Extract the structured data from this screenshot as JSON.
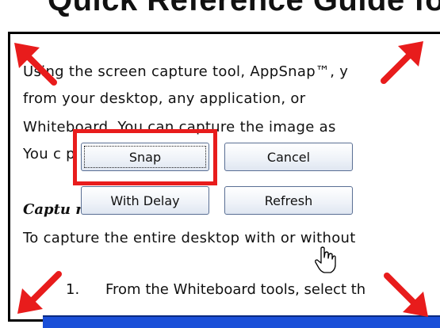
{
  "document": {
    "title": "Quick Reference Guide fo",
    "paragraph_lines": [
      "Using the screen capture tool, AppSnap™, y",
      "from your desktop, any application, or",
      "Whiteboard. You can capture the image as",
      "You c                                        p or a sele"
    ],
    "section_heading": "Captu                    re",
    "body_line": "To capture the entire desktop with or without",
    "step_number": "1.",
    "step_text": "From the Whiteboard tools, select th"
  },
  "dialog": {
    "snap_label": "Snap",
    "cancel_label": "Cancel",
    "with_delay_label": "With Delay",
    "refresh_label": "Refresh"
  },
  "annotations": {
    "highlight_color": "#e81c1c",
    "arrow_color": "#e81c1c"
  },
  "icons": [
    "arrow-icon",
    "hand-pointer-icon"
  ]
}
